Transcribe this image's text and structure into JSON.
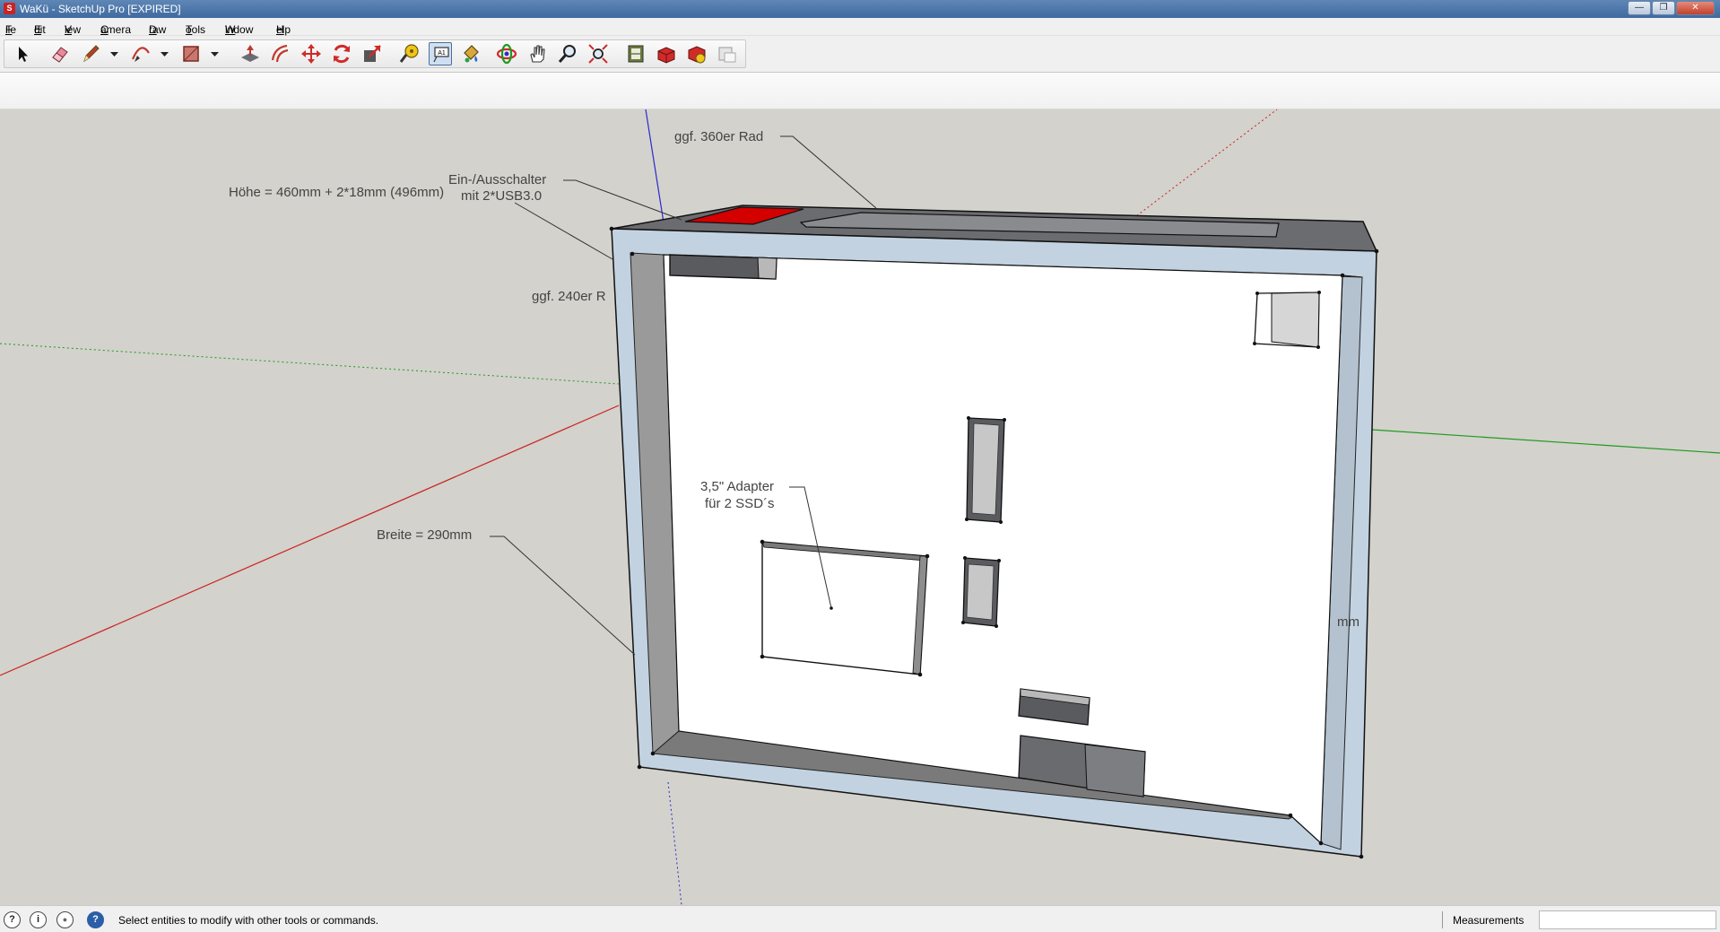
{
  "window": {
    "title": "WaKü - SketchUp Pro [EXPIRED]",
    "app_icon_letter": "S",
    "controls": {
      "minimize": "—",
      "maximize": "❐",
      "close": "✕"
    }
  },
  "menu": {
    "items": [
      {
        "mnemonic": "F",
        "rest": "ile"
      },
      {
        "mnemonic": "E",
        "rest": "dit"
      },
      {
        "mnemonic": "V",
        "rest": "iew"
      },
      {
        "mnemonic": "C",
        "rest": "amera"
      },
      {
        "mnemonic": "D",
        "rest": "raw"
      },
      {
        "mnemonic": "T",
        "rest": "ools"
      },
      {
        "mnemonic": "W",
        "rest": "indow"
      },
      {
        "mnemonic": "H",
        "rest": "elp"
      }
    ]
  },
  "toolbar": {
    "tools": [
      {
        "name": "select-icon",
        "active": false
      },
      {
        "name": "eraser-icon",
        "active": false
      },
      {
        "name": "pencil-icon",
        "active": false
      },
      {
        "name": "arc-icon",
        "active": false
      },
      {
        "name": "rectangle-icon",
        "active": false
      },
      {
        "name": "push-pull-icon",
        "active": false
      },
      {
        "name": "offset-icon",
        "active": false
      },
      {
        "name": "move-icon",
        "active": false
      },
      {
        "name": "rotate-icon",
        "active": false
      },
      {
        "name": "scale-icon",
        "active": false
      },
      {
        "name": "tape-measure-icon",
        "active": false
      },
      {
        "name": "text-icon",
        "active": true
      },
      {
        "name": "paint-bucket-icon",
        "active": false
      },
      {
        "name": "orbit-icon",
        "active": false
      },
      {
        "name": "pan-icon",
        "active": false
      },
      {
        "name": "zoom-icon",
        "active": false
      },
      {
        "name": "zoom-extents-icon",
        "active": false
      },
      {
        "name": "3d-warehouse-icon",
        "active": false
      },
      {
        "name": "share-model-icon",
        "active": false
      },
      {
        "name": "extension-warehouse-icon",
        "active": false
      },
      {
        "name": "layout-icon",
        "active": false
      }
    ],
    "accent_red": "#d12a2a",
    "active_bg": "#cfdff2"
  },
  "viewport": {
    "background": "#d3d2cc",
    "labels": {
      "rad360": "ggf. 360er Rad",
      "switch_line1": "Ein-/Ausschalter",
      "switch_line2": "mit 2*USB3.0",
      "height": "Höhe = 460mm + 2*18mm (496mm)",
      "rad240": "ggf. 240er R",
      "adapter_line1": "3,5\" Adapter",
      "adapter_line2": "für 2 SSD´s",
      "width": "Breite = 290mm",
      "depth_fragment": "mm"
    },
    "colors": {
      "panel_edge": "#c3d2e0",
      "panel_inner": "#8e8e8e",
      "back_wall": "#ffffff",
      "cutout_dark": "#5a5b5e",
      "cutout_red": "#d40000",
      "axis_red": "#cc1f1f",
      "axis_green": "#1f9a1f",
      "axis_blue": "#2a2ad0"
    }
  },
  "status": {
    "geo_icon": "?",
    "credits_icon": "i",
    "user_icon": "●",
    "help_icon": "?",
    "message": "Select entities to modify with other tools or commands.",
    "measurements_label": "Measurements",
    "measurements_value": ""
  }
}
